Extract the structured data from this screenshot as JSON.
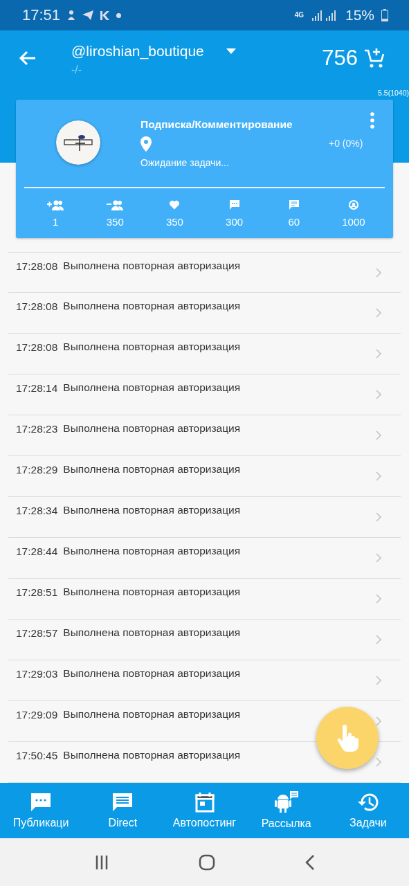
{
  "status_bar": {
    "time": "17:51",
    "network": "4G",
    "battery": "15%"
  },
  "app_bar": {
    "account": "@liroshian_boutique",
    "subtitle": "-/-",
    "balance": "756"
  },
  "version": "5.5(1040)",
  "task_card": {
    "title": "Подписка/Комментирование",
    "status": "Ожидание задачи...",
    "progress": "+0 (0%)",
    "stats": [
      {
        "kind": "follow",
        "value": "1"
      },
      {
        "kind": "unfollow",
        "value": "350"
      },
      {
        "kind": "like",
        "value": "350"
      },
      {
        "kind": "comment",
        "value": "300"
      },
      {
        "kind": "message",
        "value": "60"
      },
      {
        "kind": "account",
        "value": "1000"
      }
    ]
  },
  "log": [
    {
      "time": "17:28:08",
      "text": "Выполнена повторная авторизация"
    },
    {
      "time": "17:28:08",
      "text": "Выполнена повторная авторизация"
    },
    {
      "time": "17:28:08",
      "text": "Выполнена повторная авторизация"
    },
    {
      "time": "17:28:14",
      "text": "Выполнена повторная авторизация"
    },
    {
      "time": "17:28:23",
      "text": "Выполнена повторная авторизация"
    },
    {
      "time": "17:28:29",
      "text": "Выполнена повторная авторизация"
    },
    {
      "time": "17:28:34",
      "text": "Выполнена повторная авторизация"
    },
    {
      "time": "17:28:44",
      "text": "Выполнена повторная авторизация"
    },
    {
      "time": "17:28:51",
      "text": "Выполнена повторная авторизация"
    },
    {
      "time": "17:28:57",
      "text": "Выполнена повторная авторизация"
    },
    {
      "time": "17:29:03",
      "text": "Выполнена повторная авторизация"
    },
    {
      "time": "17:29:09",
      "text": "Выполнена повторная авторизация"
    },
    {
      "time": "17:50:45",
      "text": "Выполнена повторная авторизация"
    }
  ],
  "bottom_nav": [
    {
      "kind": "publications",
      "label": "Публикаци"
    },
    {
      "kind": "direct",
      "label": "Direct"
    },
    {
      "kind": "autopost",
      "label": "Автопостинг"
    },
    {
      "kind": "mailing",
      "label": "Рассылка"
    },
    {
      "kind": "tasks",
      "label": "Задачи"
    }
  ]
}
